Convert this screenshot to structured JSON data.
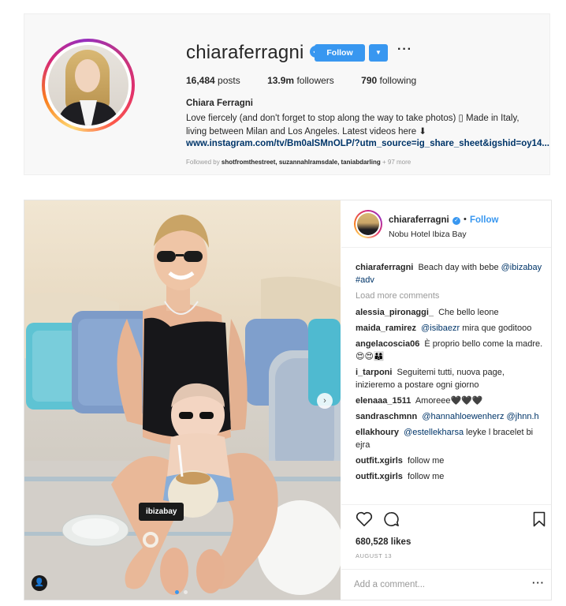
{
  "profile": {
    "username": "chiaraferragni",
    "verified_badge": "✓",
    "follow_label": "Follow",
    "dropdown_icon": "chevron-down-icon",
    "more_label": "···",
    "stats": {
      "posts_count": "16,484",
      "posts_label": "posts",
      "followers_count": "13.9m",
      "followers_label": "followers",
      "following_count": "790",
      "following_label": "following"
    },
    "full_name": "Chiara Ferragni",
    "bio": "Love fiercely (and don't forget to stop along the way to take photos) ▯ Made in Italy, living between Milan and Los Angeles. Latest videos here ⬇",
    "link": "www.instagram.com/tv/Bm0aISMnOLP/?utm_source=ig_share_sheet&igshid=oy14...",
    "followed_by_prefix": "Followed by",
    "followed_by_users": "shotfromthestreet, suzannahlramsdale, taniabdarling",
    "followed_by_more": "+ 97 more"
  },
  "post": {
    "photo_tag": "ibizabay",
    "username": "chiaraferragni",
    "follow_label": "Follow",
    "dot": "•",
    "location": "Nobu Hotel Ibiza Bay",
    "caption": {
      "user": "chiaraferragni",
      "text": "Beach day with bebe",
      "mention": "@ibizabay",
      "hashtag": "#adv"
    },
    "load_more": "Load more comments",
    "comments": [
      {
        "user": "alessia_pironaggi_",
        "mention": "",
        "text": "Che bello leone"
      },
      {
        "user": "maida_ramirez",
        "mention": "@isibaezr",
        "text": "mira que goditooo"
      },
      {
        "user": "angelacoscia06",
        "mention": "",
        "text": "È proprio bello come la madre. 😍😍👨‍👩‍👦"
      },
      {
        "user": "i_tarponi",
        "mention": "",
        "text": "Seguitemi tutti, nuova page, inizieremo a postare ogni giorno"
      },
      {
        "user": "elenaaa_1511",
        "mention": "",
        "text": "Amoreee🖤🖤🖤"
      },
      {
        "user": "sandraschmnn",
        "mention": "@hannahloewenherz @jhnn.h",
        "text": ""
      },
      {
        "user": "ellakhoury",
        "mention": "@estellekharsa",
        "text": "leyke l bracelet bi ejra"
      },
      {
        "user": "outfit.xgirls",
        "mention": "",
        "text": "follow me"
      },
      {
        "user": "outfit.xgirls",
        "mention": "",
        "text": "follow me"
      }
    ],
    "likes": "680,528 likes",
    "date": "AUGUST 13",
    "add_comment_placeholder": "Add a comment...",
    "more_options_label": "···"
  },
  "colors": {
    "accent": "#3897f0",
    "link": "#003569",
    "muted": "#999999"
  }
}
